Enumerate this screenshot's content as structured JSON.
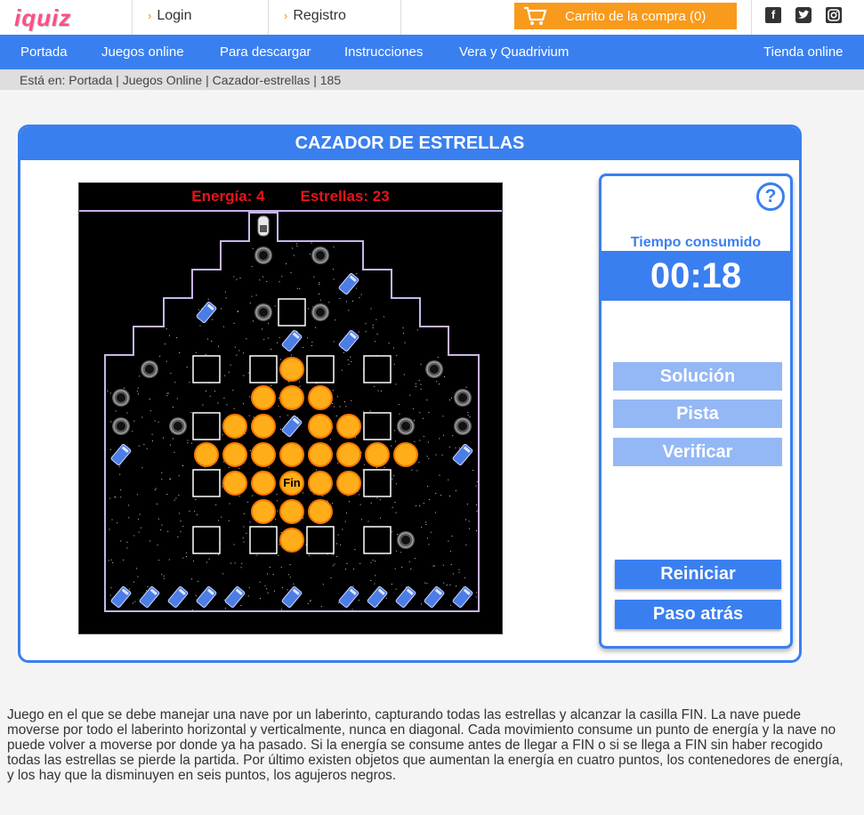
{
  "header": {
    "logo_text": "iquiz",
    "login": "Login",
    "register": "Registro",
    "cart": "Carrito de la compra (0)"
  },
  "social": [
    "facebook-icon",
    "twitter-icon",
    "instagram-icon"
  ],
  "nav": [
    "Portada",
    "Juegos online",
    "Para descargar",
    "Instrucciones",
    "Vera y Quadrivium",
    "Tienda online"
  ],
  "breadcrumb": "Está en: Portada | Juegos Online | Cazador-estrellas | 185",
  "game": {
    "title": "CAZADOR DE ESTRELLAS",
    "energy": "Energía: 4",
    "stars": "Estrellas: 23",
    "fin_label": "Fin",
    "grid": [
      "..........",
      ".......S..",
      "....CHHC..",
      "...CHHHHC.",
      "..CHOHOHC.",
      ".HOHBBHOH.",
      "OOHHHHHHHO",
      "OOHEDHHEHO",
      "CHDHHHDHHC",
      "CHDFHHDHHC",
      "HHOHHHOHHH",
      "HHOHBHOOBH",
      "CCCCCHCCCC"
    ],
    "cells": [
      [
        "wall",
        "wall",
        "wall",
        "wall",
        "wall",
        "ship",
        "wall",
        "wall",
        "wall",
        "wall",
        "wall",
        "wall",
        "wall",
        "wall",
        "wall"
      ],
      [
        "wall",
        "wall",
        "wall",
        "wall",
        "wall",
        "hole",
        "space",
        "hole",
        "wall",
        "wall",
        "wall",
        "wall",
        "wall",
        "wall",
        "wall"
      ],
      [
        "wall",
        "wall",
        "wall",
        "wall",
        "space",
        "space",
        "space",
        "space",
        "can",
        "wall",
        "wall",
        "wall",
        "wall",
        "wall",
        "wall"
      ],
      [
        "wall",
        "wall",
        "wall",
        "can",
        "space",
        "hole",
        "empty",
        "hole",
        "space",
        "space",
        "wall",
        "wall",
        "wall",
        "wall",
        "wall"
      ],
      [
        "wall",
        "wall",
        "space",
        "space",
        "space",
        "space",
        "can",
        "space",
        "can",
        "space",
        "space",
        "wall",
        "wall",
        "wall",
        "wall"
      ],
      [
        "wall",
        "hole",
        "space",
        "empty",
        "space",
        "empty",
        "star",
        "empty",
        "space",
        "empty",
        "space",
        "hole",
        "wall",
        "wall",
        "wall"
      ],
      [
        "hole",
        "space",
        "space",
        "space",
        "space",
        "star",
        "star",
        "star",
        "space",
        "space",
        "space",
        "space",
        "hole",
        "wall",
        "wall"
      ],
      [
        "hole",
        "space",
        "hole",
        "empty",
        "star",
        "star",
        "can",
        "star",
        "star",
        "empty",
        "hole",
        "space",
        "hole",
        "wall",
        "wall"
      ],
      [
        "can",
        "space",
        "space",
        "star",
        "star",
        "star",
        "star",
        "star",
        "star",
        "star",
        "star",
        "space",
        "can",
        "wall",
        "wall"
      ],
      [
        "space",
        "space",
        "space",
        "empty",
        "star",
        "star",
        "fin",
        "star",
        "star",
        "empty",
        "space",
        "space",
        "space",
        "wall",
        "wall"
      ],
      [
        "space",
        "space",
        "space",
        "space",
        "space",
        "star",
        "star",
        "star",
        "space",
        "space",
        "space",
        "space",
        "space",
        "wall",
        "wall"
      ],
      [
        "space",
        "space",
        "space",
        "empty",
        "space",
        "empty",
        "star",
        "empty",
        "space",
        "empty",
        "hole",
        "space",
        "space",
        "wall",
        "wall"
      ],
      [
        "space",
        "space",
        "space",
        "space",
        "space",
        "space",
        "space",
        "space",
        "space",
        "space",
        "space",
        "space",
        "space",
        "wall",
        "wall"
      ],
      [
        "can",
        "can",
        "can",
        "can",
        "can",
        "space",
        "can",
        "space",
        "can",
        "can",
        "can",
        "can",
        "can",
        "wall",
        "wall"
      ]
    ]
  },
  "side": {
    "help": "?",
    "time_label": "Tiempo consumido",
    "time": "00:18",
    "solution": "Solución",
    "hint": "Pista",
    "verify": "Verificar",
    "restart": "Reiniciar",
    "undo": "Paso atrás"
  },
  "description": "Juego en el que se debe manejar una nave por un laberinto, capturando todas las estrellas y alcanzar la casilla FIN. La nave puede moverse por todo el laberinto horizontal y verticalmente, nunca en diagonal. Cada movimiento consume un punto de energía y la nave no puede volver a moverse por donde ya ha pasado. Si la energía se consume antes de llegar a FIN o si se llega a FIN sin haber recogido todas las estrellas se pierde la partida. Por último existen objetos que aumentan la energía en cuatro puntos, los contenedores de energía, y los hay que la disminuyen en seis puntos, los agujeros negros."
}
